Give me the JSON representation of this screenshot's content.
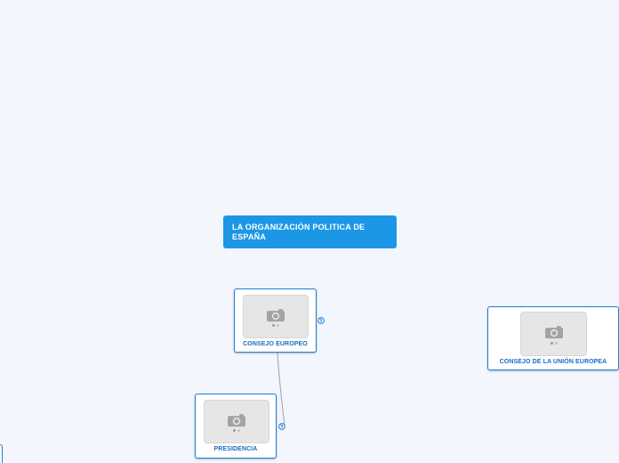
{
  "map": {
    "root": {
      "label": "LA ORGANIZACIÓN POLITICA DE ESPAÑA"
    },
    "nodes": [
      {
        "id": "consejo-europeo",
        "label": "CONSEJO EUROPEO",
        "image": "camera-placeholder-icon"
      },
      {
        "id": "presidencia",
        "label": "PRESIDENCIA",
        "image": "camera-placeholder-icon"
      },
      {
        "id": "consejo-union-europea",
        "label": "CONSEJO DE LA UNIÓN EUROPEA",
        "image": "camera-placeholder-icon"
      }
    ],
    "link_icon": "globe-link-icon"
  },
  "colors": {
    "background": "#f3f6fd",
    "root_fill": "#1b97e6",
    "card_border": "#1e7fd6",
    "card_label": "#1a6cc4",
    "connector": "#9aa3ad"
  }
}
